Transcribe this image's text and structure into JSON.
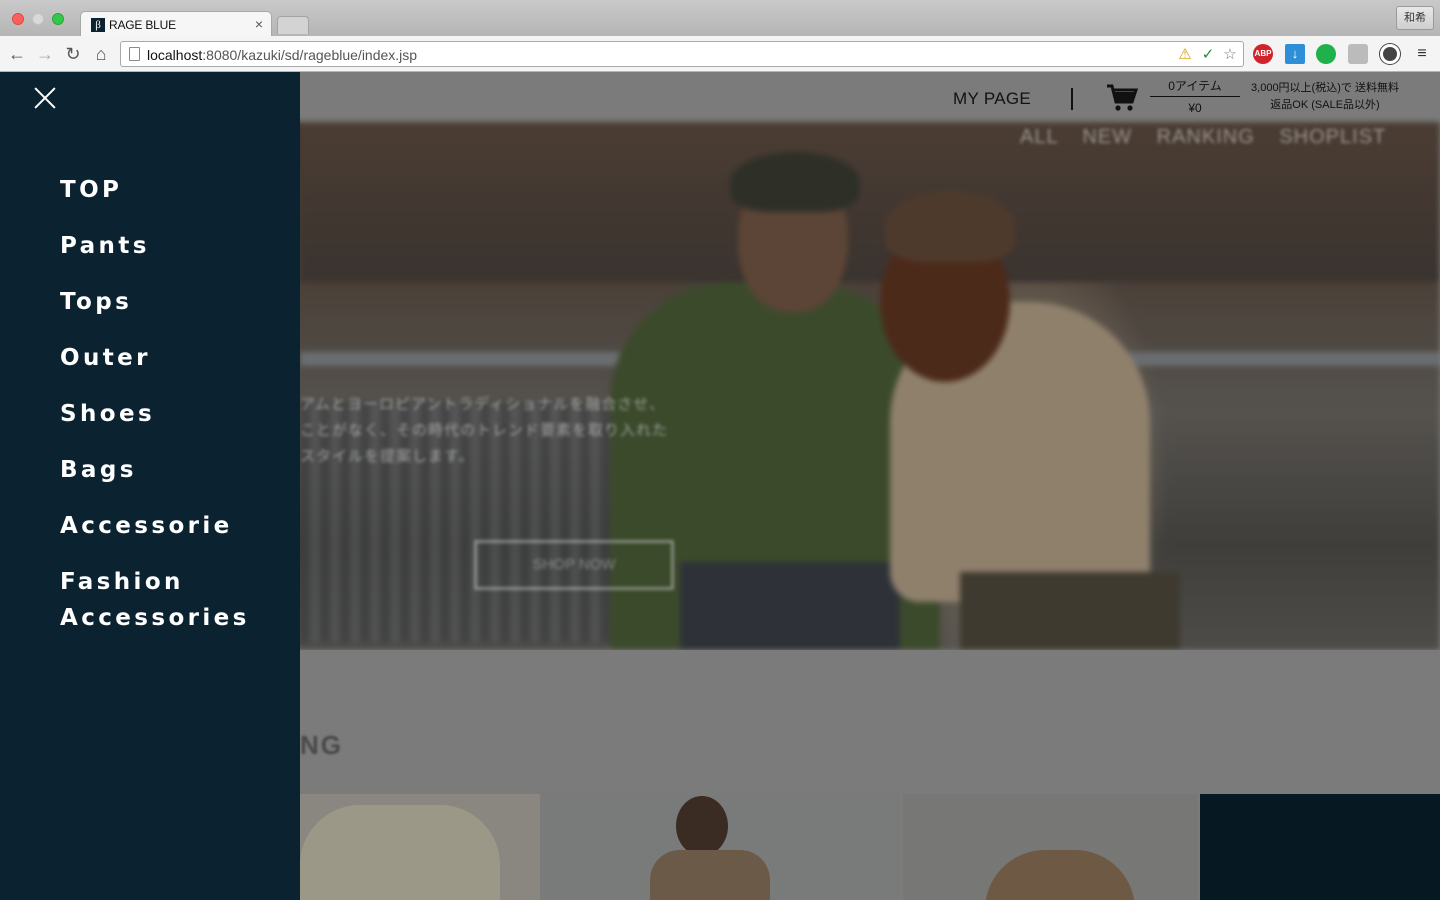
{
  "browser": {
    "tab_title": "RAGE BLUE",
    "tab_close": "×",
    "ime_label": "和希",
    "url_host": "localhost",
    "url_rest": ":8080/kazuki/sd/rageblue/index.jsp",
    "extensions": [
      "warning-icon",
      "check-icon",
      "star-icon",
      "adblock-icon",
      "download-icon",
      "evernote-icon",
      "tool-icon",
      "record-icon",
      "menu-icon"
    ],
    "adblock_label": "ABP"
  },
  "header": {
    "my_page": "MY PAGE",
    "cart_count": "0アイテム",
    "cart_total": "¥0",
    "shipping_line1": "3,000円以上(税込)で 送料無料",
    "shipping_line2": "返品OK (SALE品以外)"
  },
  "hero": {
    "nav": [
      "ALL",
      "NEW",
      "RANKING",
      "SHOPLIST"
    ],
    "text_lines": [
      "アムとヨーロピアントラディショナルを融合させ、",
      "ことがなく、その時代のトレンド要素を取り入れた",
      "スタイルを提案します。"
    ],
    "cta": "SHOP NOW"
  },
  "section": {
    "ranking_heading": "NG"
  },
  "drawer": {
    "close_icon": "close-icon",
    "items": [
      "TOP",
      "Pants",
      "Tops",
      "Outer",
      "Shoes",
      "Bags",
      "Accessorie",
      "Fashion Accessories"
    ]
  },
  "colors": {
    "drawer_bg": "#0b2230",
    "overlay": "#7b7b7b",
    "drawer_text": "#ffffff"
  }
}
